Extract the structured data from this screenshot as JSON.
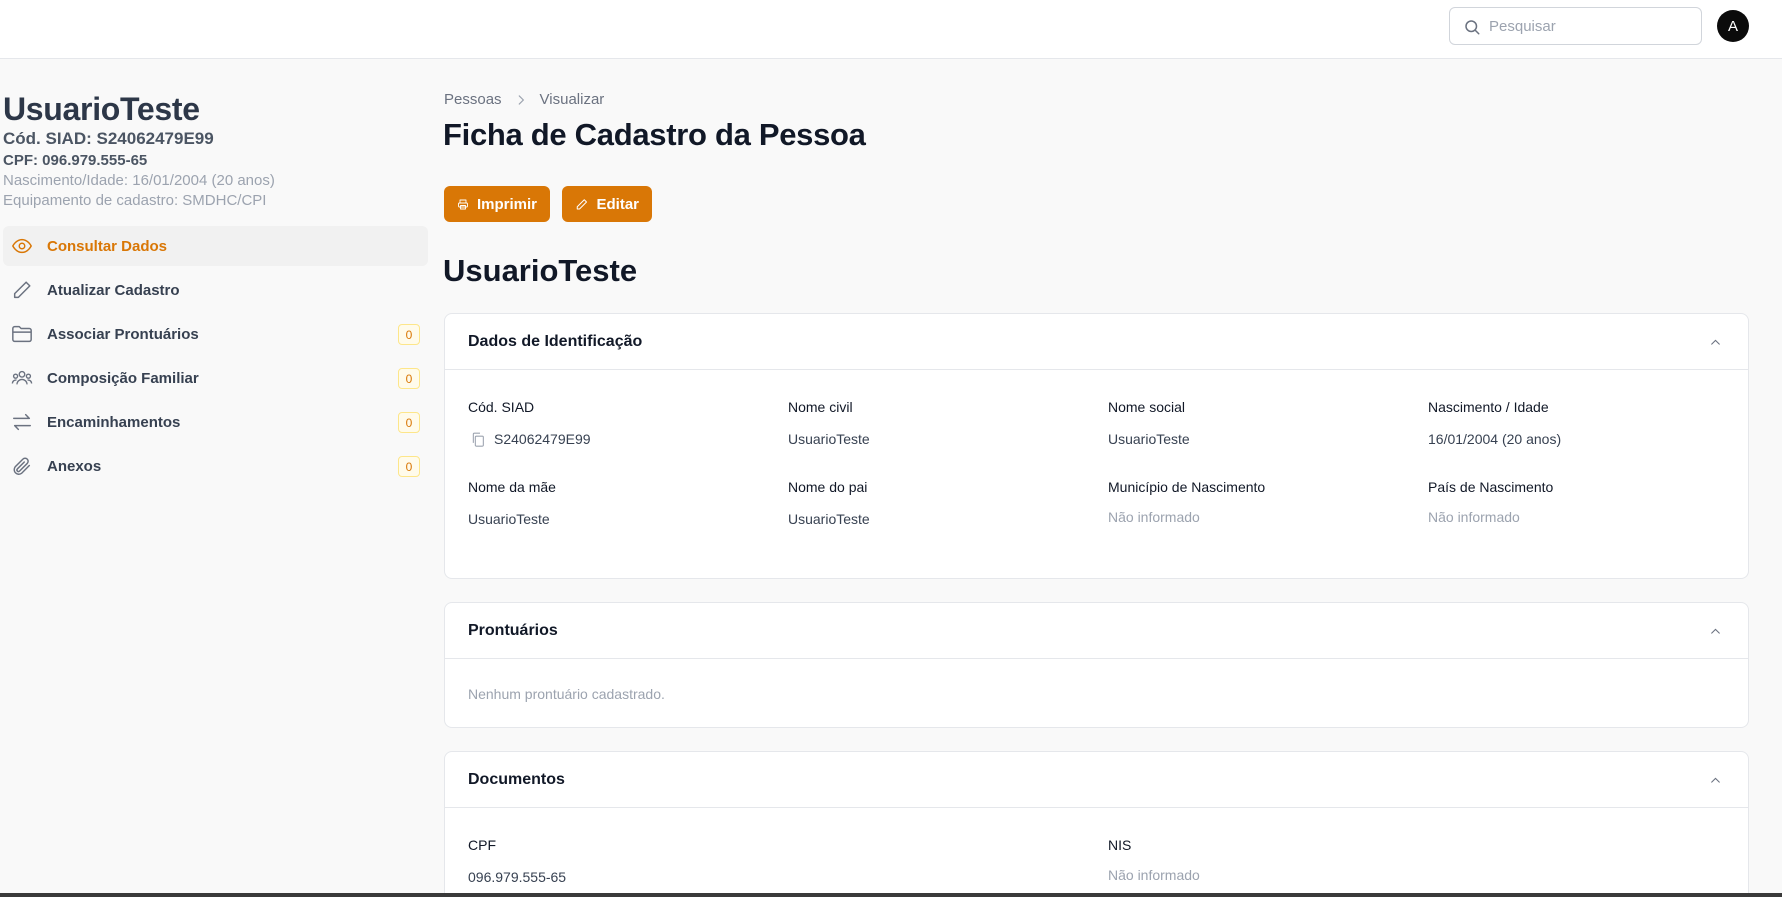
{
  "search": {
    "placeholder": "Pesquisar"
  },
  "user": {
    "avatar_letter": "A"
  },
  "person": {
    "name": "UsuarioTeste",
    "siad": "Cód. SIAD: S24062479E99",
    "cpf": "CPF: 096.979.555-65",
    "birth": "Nascimento/Idade: 16/01/2004 (20 anos)",
    "equipment": "Equipamento de cadastro: SMDHC/CPI"
  },
  "sidebar": {
    "items": [
      {
        "label": "Consultar Dados",
        "icon": "eye-icon",
        "active": true
      },
      {
        "label": "Atualizar Cadastro",
        "icon": "pencil-icon"
      },
      {
        "label": "Associar Prontuários",
        "icon": "folder-icon",
        "badge": "0"
      },
      {
        "label": "Composição Familiar",
        "icon": "users-icon",
        "badge": "0"
      },
      {
        "label": "Encaminhamentos",
        "icon": "arrows-exchange-icon",
        "badge": "0"
      },
      {
        "label": "Anexos",
        "icon": "paperclip-icon",
        "badge": "0"
      }
    ]
  },
  "breadcrumb": {
    "items": [
      "Pessoas",
      "Visualizar"
    ]
  },
  "main": {
    "title": "Ficha de Cadastro da Pessoa",
    "print_label": "Imprimir",
    "edit_label": "Editar",
    "name_heading": "UsuarioTeste"
  },
  "identification": {
    "title": "Dados de Identificação",
    "fields": [
      {
        "label": "Cód. SIAD",
        "value": "S24062479E99"
      },
      {
        "label": "Nome civil",
        "value": "UsuarioTeste"
      },
      {
        "label": "Nome social",
        "value": "UsuarioTeste"
      },
      {
        "label": "Nascimento / Idade",
        "value": "16/01/2004 (20 anos)"
      },
      {
        "label": "Nome da mãe",
        "value": "UsuarioTeste"
      },
      {
        "label": "Nome do pai",
        "value": "UsuarioTeste"
      },
      {
        "label": "Município de Nascimento",
        "value": "Não informado"
      },
      {
        "label": "País de Nascimento",
        "value": "Não informado"
      }
    ]
  },
  "prontuarios": {
    "title": "Prontuários",
    "empty": "Nenhum prontuário cadastrado."
  },
  "documentos": {
    "title": "Documentos",
    "fields": [
      {
        "label": "CPF",
        "value": "096.979.555-65"
      },
      {
        "label": "NIS",
        "value": "Não informado"
      }
    ]
  },
  "colors": {
    "accent": "#d97706",
    "text": "#111827",
    "muted": "#9ca3af"
  }
}
